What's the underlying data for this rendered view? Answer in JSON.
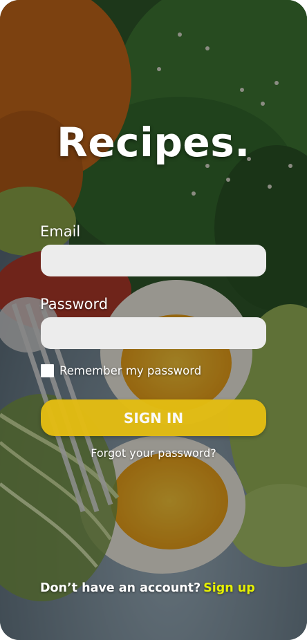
{
  "app": {
    "title": "Recipes."
  },
  "form": {
    "email_label": "Email",
    "email_value": "",
    "email_placeholder": "",
    "password_label": "Password",
    "password_value": "",
    "password_placeholder": "",
    "remember_label": "Remember my password",
    "remember_checked": false,
    "signin_label": "SIGN IN",
    "forgot_label": "Forgot your password?"
  },
  "footer": {
    "prompt": "Don’t have an account?",
    "signup_label": "Sign up"
  },
  "colors": {
    "accent": "#e4bd12",
    "link": "#e6f000",
    "input_bg": "#ececec"
  },
  "icons": {
    "background": "food-photo-background"
  }
}
